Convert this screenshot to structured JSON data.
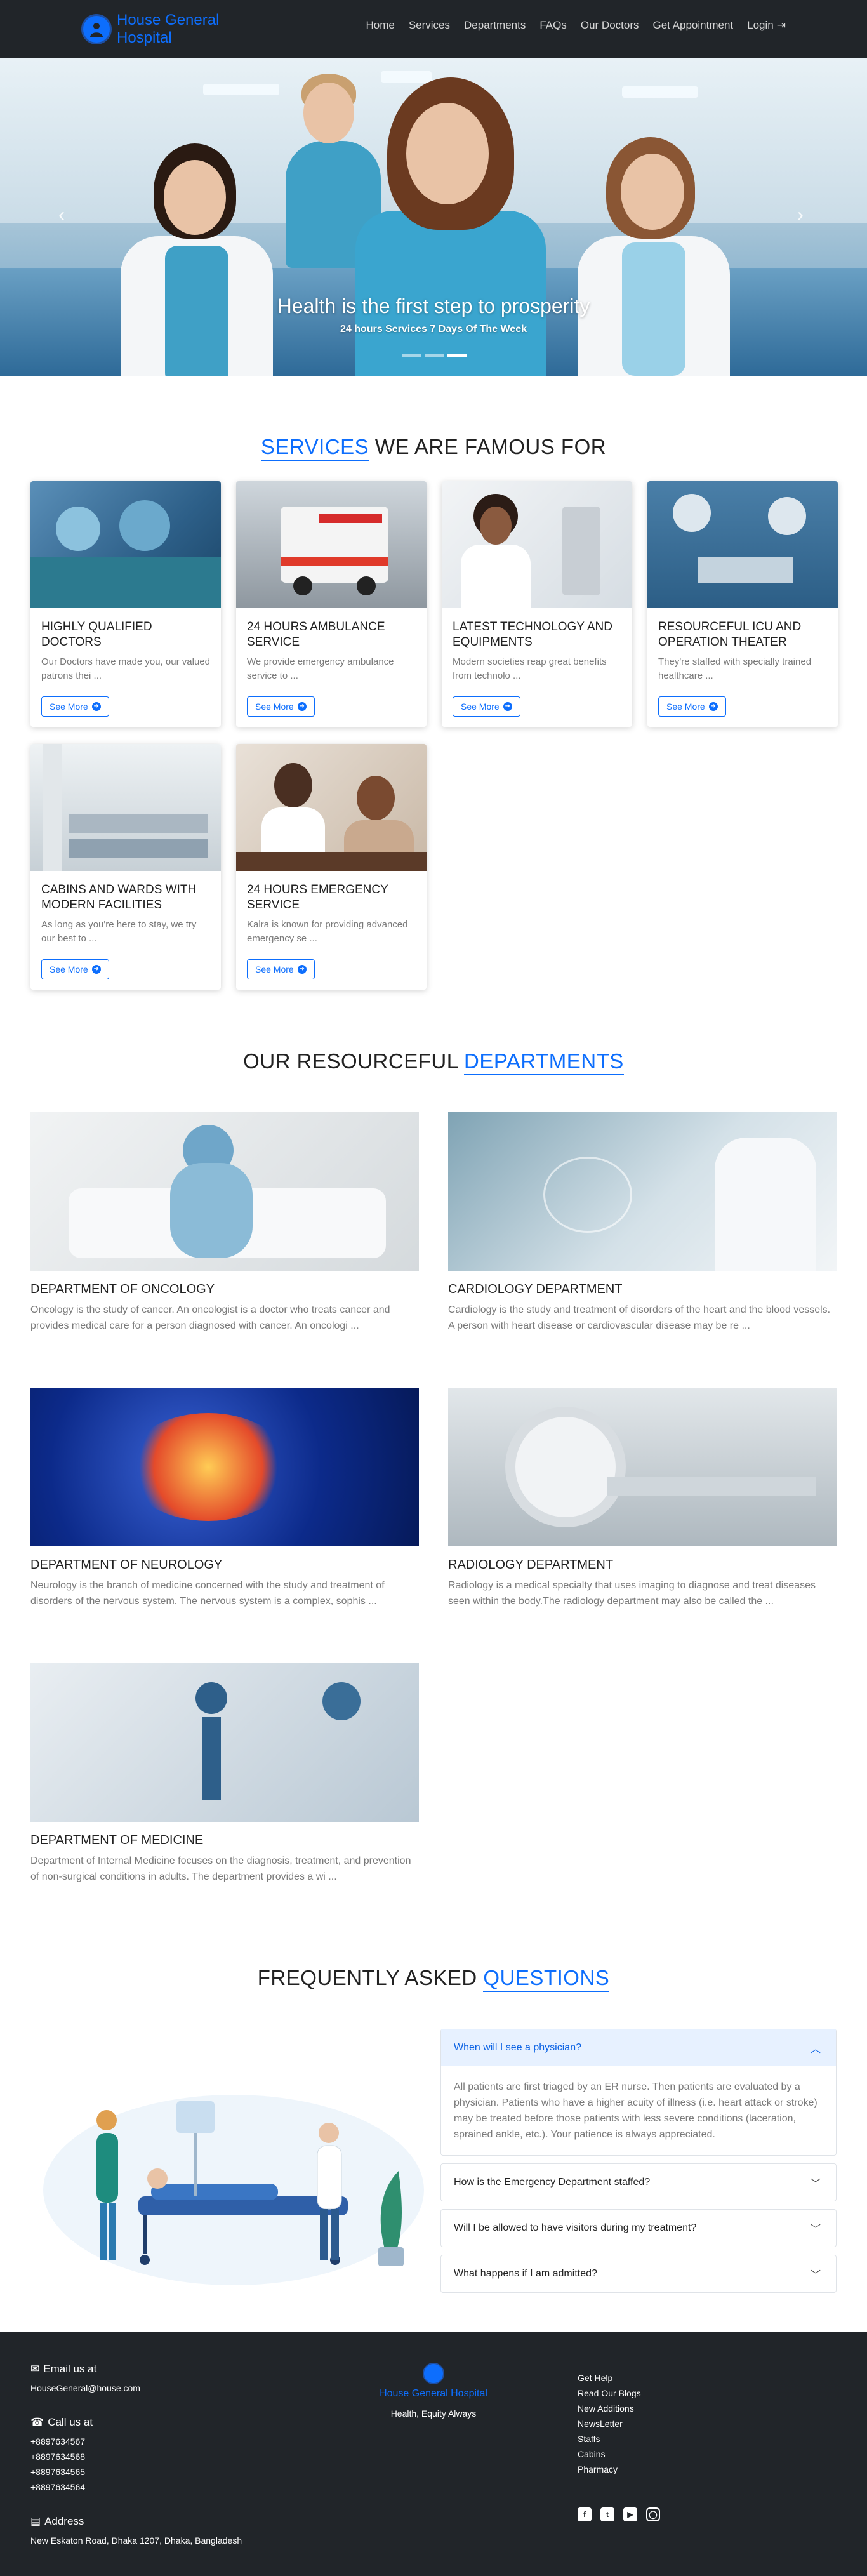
{
  "nav": {
    "brand": "House General Hospital",
    "links": [
      "Home",
      "Services",
      "Departments",
      "FAQs",
      "Our Doctors",
      "Get Appointment",
      "Login"
    ]
  },
  "hero": {
    "title": "Health is the first step to prosperity",
    "subtitle": "24 hours Services 7 Days Of The Week",
    "slide_count": 3,
    "active_slide": 3
  },
  "services": {
    "title_plain": "WE ARE FAMOUS FOR",
    "title_accent": "SERVICES",
    "button_label": "See More",
    "cards": [
      {
        "title": "HIGHLY QUALIFIED DOCTORS",
        "text": "Our Doctors have made you, our valued patrons thei ..."
      },
      {
        "title": "24 HOURS AMBULANCE SERVICE",
        "text": "We provide emergency ambulance service to ..."
      },
      {
        "title": "LATEST TECHNOLOGY AND EQUIPMENTS",
        "text": "Modern societies reap great benefits from technolo ..."
      },
      {
        "title": "RESOURCEFUL ICU AND OPERATION THEATER",
        "text": "They're staffed with specially trained healthcare ..."
      },
      {
        "title": "CABINS AND WARDS WITH MODERN FACILITIES",
        "text": "As long as you're here to stay, we try our best to ..."
      },
      {
        "title": "24 HOURS EMERGENCY SERVICE",
        "text": "Kalra is known for providing advanced emergency se ..."
      }
    ]
  },
  "departments": {
    "title_plain": "OUR RESOURCEFUL",
    "title_accent": "DEPARTMENTS",
    "items": [
      {
        "title": "DEPARTMENT OF ONCOLOGY",
        "text": "Oncology is the study of cancer. An oncologist is a doctor who treats cancer and provides medical care for a person diagnosed with cancer. An oncologi ..."
      },
      {
        "title": "CARDIOLOGY DEPARTMENT",
        "text": "Cardiology is the study and treatment of disorders of the heart and the blood vessels. A person with heart disease or cardiovascular disease may be re ..."
      },
      {
        "title": "DEPARTMENT OF NEUROLOGY",
        "text": "Neurology is the branch of medicine concerned with the study and treatment of disorders of the nervous system. The nervous system is a complex, sophis ..."
      },
      {
        "title": "RADIOLOGY DEPARTMENT",
        "text": "Radiology is a medical specialty that uses imaging to diagnose and treat diseases seen within the body.The radiology department may also be called the ..."
      },
      {
        "title": "DEPARTMENT OF MEDICINE",
        "text": "Department of Internal Medicine focuses on the diagnosis, treatment, and prevention of non-surgical conditions in adults. The department provides a wi ..."
      }
    ]
  },
  "faq": {
    "title_plain": "FREQUENTLY ASKED",
    "title_accent": "QUESTIONS",
    "items": [
      {
        "q": "When will I see a physician?",
        "a": "All patients are first triaged by an ER nurse. Then patients are evaluated by a physician. Patients who have a higher acuity of illness (i.e. heart attack or stroke) may be treated before those patients with less severe conditions (laceration, sprained ankle, etc.). Your patience is always appreciated."
      },
      {
        "q": "How is the Emergency Department staffed?",
        "a": ""
      },
      {
        "q": "Will I be allowed to have visitors during my treatment?",
        "a": ""
      },
      {
        "q": "What happens if I am admitted?",
        "a": ""
      }
    ]
  },
  "footer": {
    "email_heading": "Email us at",
    "email": "HouseGeneral@house.com",
    "call_heading": "Call us at",
    "phones": [
      "+8897634567",
      "+8897634568",
      "+8897634565",
      "+8897634564"
    ],
    "address_heading": "Address",
    "address": "New Eskaton Road, Dhaka 1207, Dhaka, Bangladesh",
    "brand": "House General Hospital",
    "tagline": "Health, Equity Always",
    "links": [
      "Get Help",
      "Read Our Blogs",
      "New Additions",
      "NewsLetter",
      "Staffs",
      "Cabins",
      "Pharmacy"
    ],
    "social": [
      "facebook-icon",
      "twitter-icon",
      "youtube-icon",
      "instagram-icon"
    ]
  },
  "colors": {
    "accent": "#0d6efd",
    "navbar_bg": "#212529",
    "muted_text": "#7a7a7a"
  }
}
